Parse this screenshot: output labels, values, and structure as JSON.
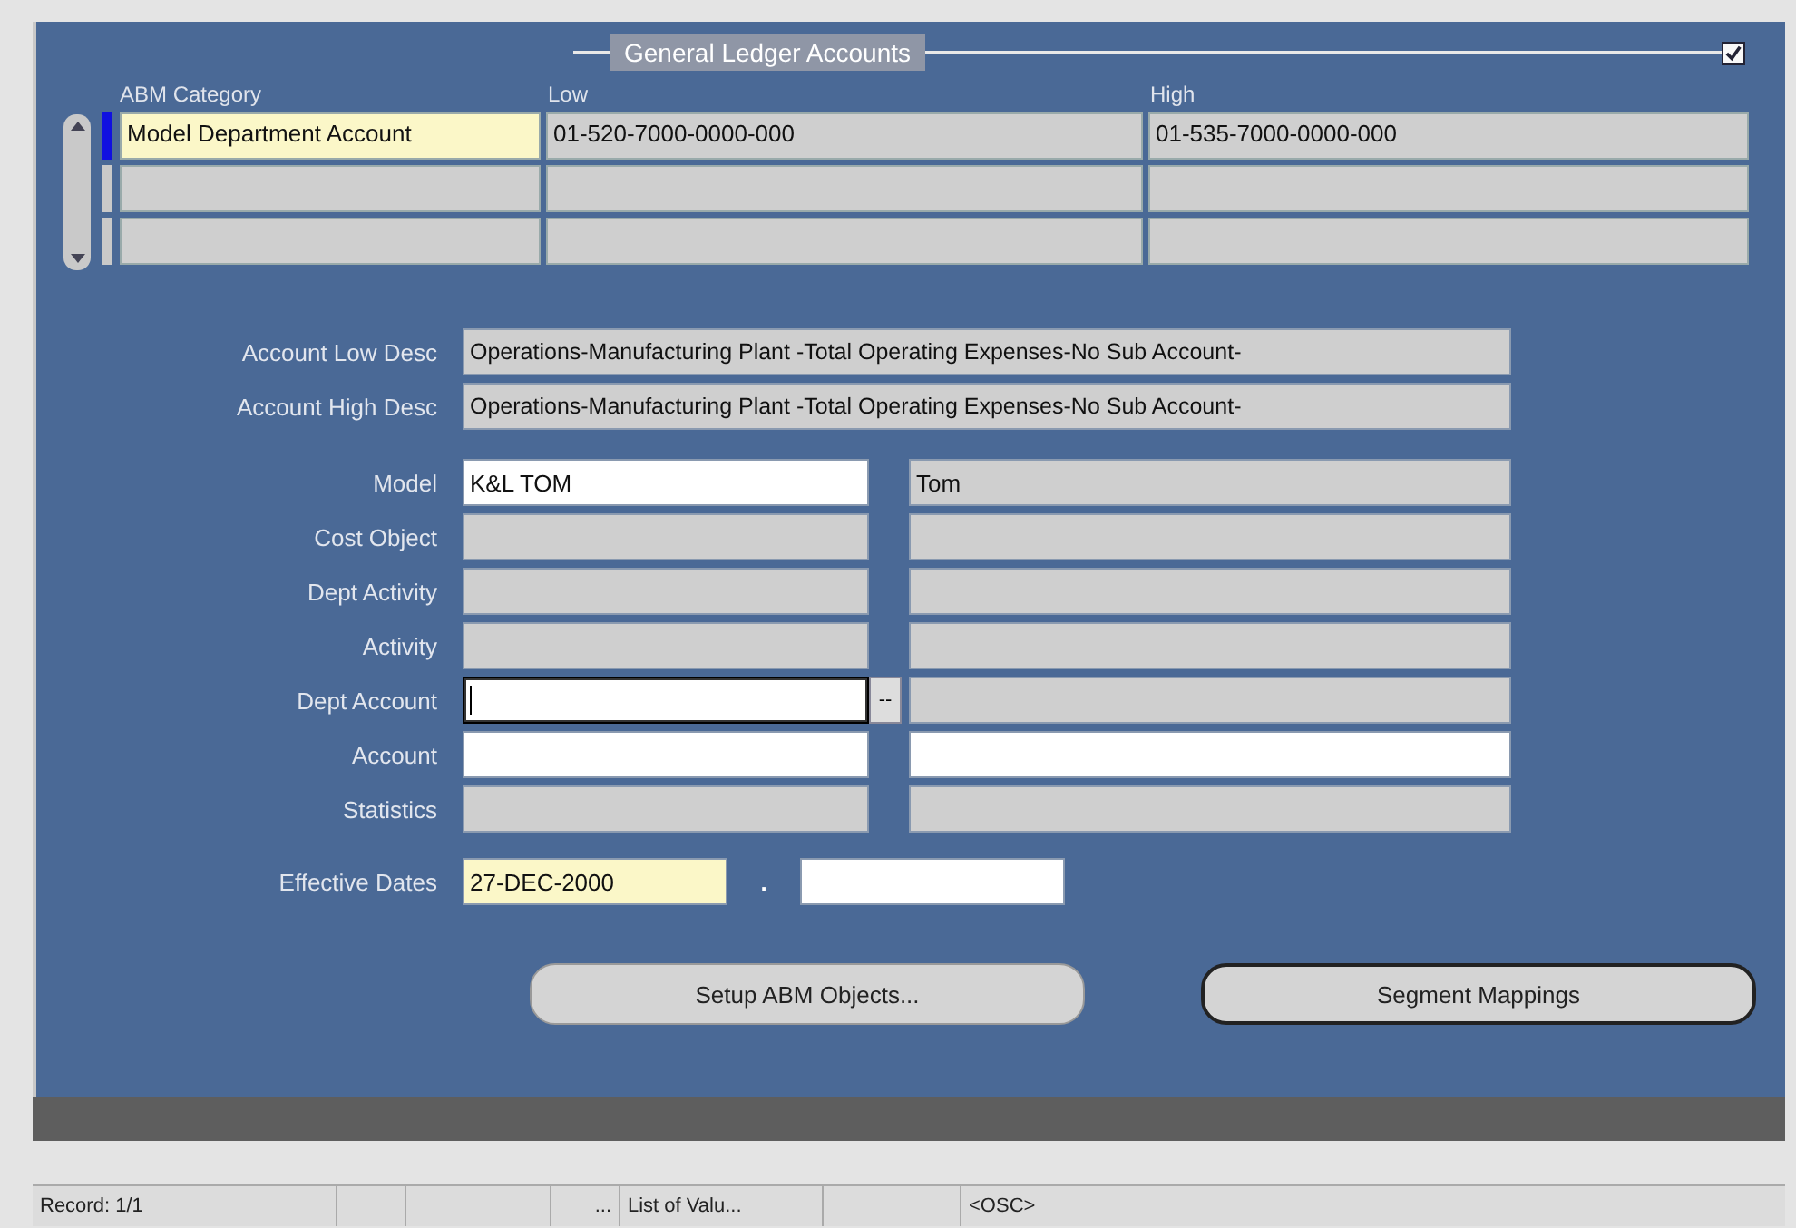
{
  "section": {
    "title": "General Ledger Accounts",
    "checked": true
  },
  "grid": {
    "columns": [
      "ABM Category",
      "Low",
      "High"
    ],
    "rows": [
      {
        "selected": true,
        "cells": [
          {
            "value": "Model Department Account",
            "required": true
          },
          {
            "value": "01-520-7000-0000-000",
            "required": false
          },
          {
            "value": "01-535-7000-0000-000",
            "required": false
          }
        ]
      },
      {
        "selected": false,
        "cells": [
          {
            "required": false
          },
          {
            "required": false
          },
          {
            "required": false
          }
        ]
      },
      {
        "selected": false,
        "cells": [
          {
            "required": false
          },
          {
            "required": false
          },
          {
            "required": false
          }
        ]
      }
    ]
  },
  "descriptions": [
    {
      "label": "Account Low Desc",
      "value": "Operations-Manufacturing Plant -Total Operating Expenses-No Sub Account-"
    },
    {
      "label": "Account High Desc",
      "value": "Operations-Manufacturing Plant -Total Operating Expenses-No Sub Account-"
    }
  ],
  "fields": [
    {
      "label": "Model",
      "code": {
        "value": "K&L TOM",
        "disabled": false,
        "focused": false
      },
      "name": {
        "value": "Tom",
        "disabled": true
      },
      "lov": false
    },
    {
      "label": "Cost Object",
      "code": {
        "disabled": true,
        "focused": false
      },
      "name": {
        "disabled": true
      },
      "lov": false
    },
    {
      "label": "Dept Activity",
      "code": {
        "disabled": true,
        "focused": false
      },
      "name": {
        "disabled": true
      },
      "lov": false
    },
    {
      "label": "Activity",
      "code": {
        "disabled": true,
        "focused": false
      },
      "name": {
        "disabled": true
      },
      "lov": false
    },
    {
      "label": "Dept Account",
      "code": {
        "disabled": false,
        "focused": true
      },
      "name": {
        "disabled": true
      },
      "lov": true,
      "lov_label": "--"
    },
    {
      "label": "Account",
      "code": {
        "disabled": false,
        "focused": false
      },
      "name": {
        "disabled": false
      },
      "lov": false
    },
    {
      "label": "Statistics",
      "code": {
        "disabled": true,
        "focused": false
      },
      "name": {
        "disabled": true
      },
      "lov": false
    }
  ],
  "effective_dates": {
    "label": "Effective Dates",
    "separator": ".",
    "from": {
      "value": "27-DEC-2000",
      "required": true
    },
    "to": {
      "required": false
    }
  },
  "buttons": [
    {
      "label": "Setup ABM Objects...",
      "default": false
    },
    {
      "label": "Segment Mappings",
      "default": true
    }
  ],
  "status_bar": [
    "Record: 1/1",
    "...",
    "List of Valu...",
    "<OSC>"
  ]
}
